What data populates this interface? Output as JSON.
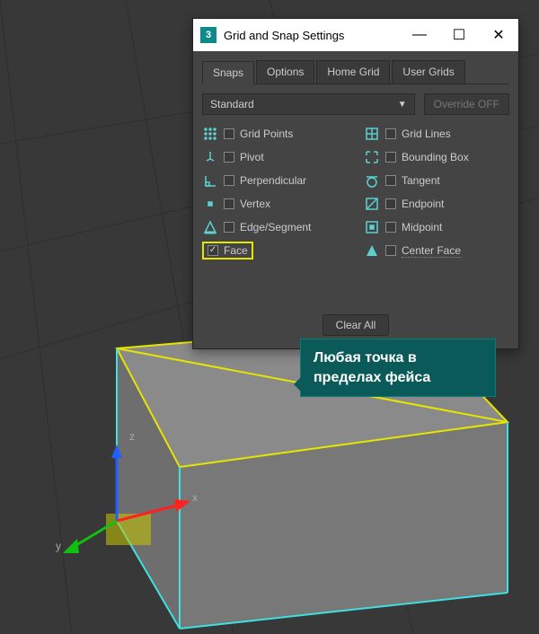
{
  "window": {
    "title": "Grid and Snap Settings",
    "app_badge": "3"
  },
  "tabs": [
    {
      "label": "Snaps",
      "active": true
    },
    {
      "label": "Options",
      "active": false
    },
    {
      "label": "Home Grid",
      "active": false
    },
    {
      "label": "User Grids",
      "active": false
    }
  ],
  "dropdown": {
    "value": "Standard"
  },
  "override_btn": "Override OFF",
  "snaps_left": [
    {
      "icon": "dots",
      "label": "Grid Points",
      "checked": false
    },
    {
      "icon": "pivot",
      "label": "Pivot",
      "checked": false
    },
    {
      "icon": "perp",
      "label": "Perpendicular",
      "checked": false
    },
    {
      "icon": "vertex",
      "label": "Vertex",
      "checked": false
    },
    {
      "icon": "edge",
      "label": "Edge/Segment",
      "checked": false
    },
    {
      "icon": "face",
      "label": "Face",
      "checked": true,
      "highlight": true
    }
  ],
  "snaps_right": [
    {
      "icon": "gridlines",
      "label": "Grid Lines",
      "checked": false
    },
    {
      "icon": "bbox",
      "label": "Bounding Box",
      "checked": false
    },
    {
      "icon": "tangent",
      "label": "Tangent",
      "checked": false
    },
    {
      "icon": "endpoint",
      "label": "Endpoint",
      "checked": false
    },
    {
      "icon": "midpoint",
      "label": "Midpoint",
      "checked": false
    },
    {
      "icon": "centerface",
      "label": "Center Face",
      "checked": false,
      "dotted": true
    }
  ],
  "clear_btn": "Clear All",
  "annotation": {
    "line1": "Любая точка в",
    "line2": "пределах фейса"
  },
  "axes": {
    "x": "x",
    "y": "y",
    "z": "z"
  }
}
